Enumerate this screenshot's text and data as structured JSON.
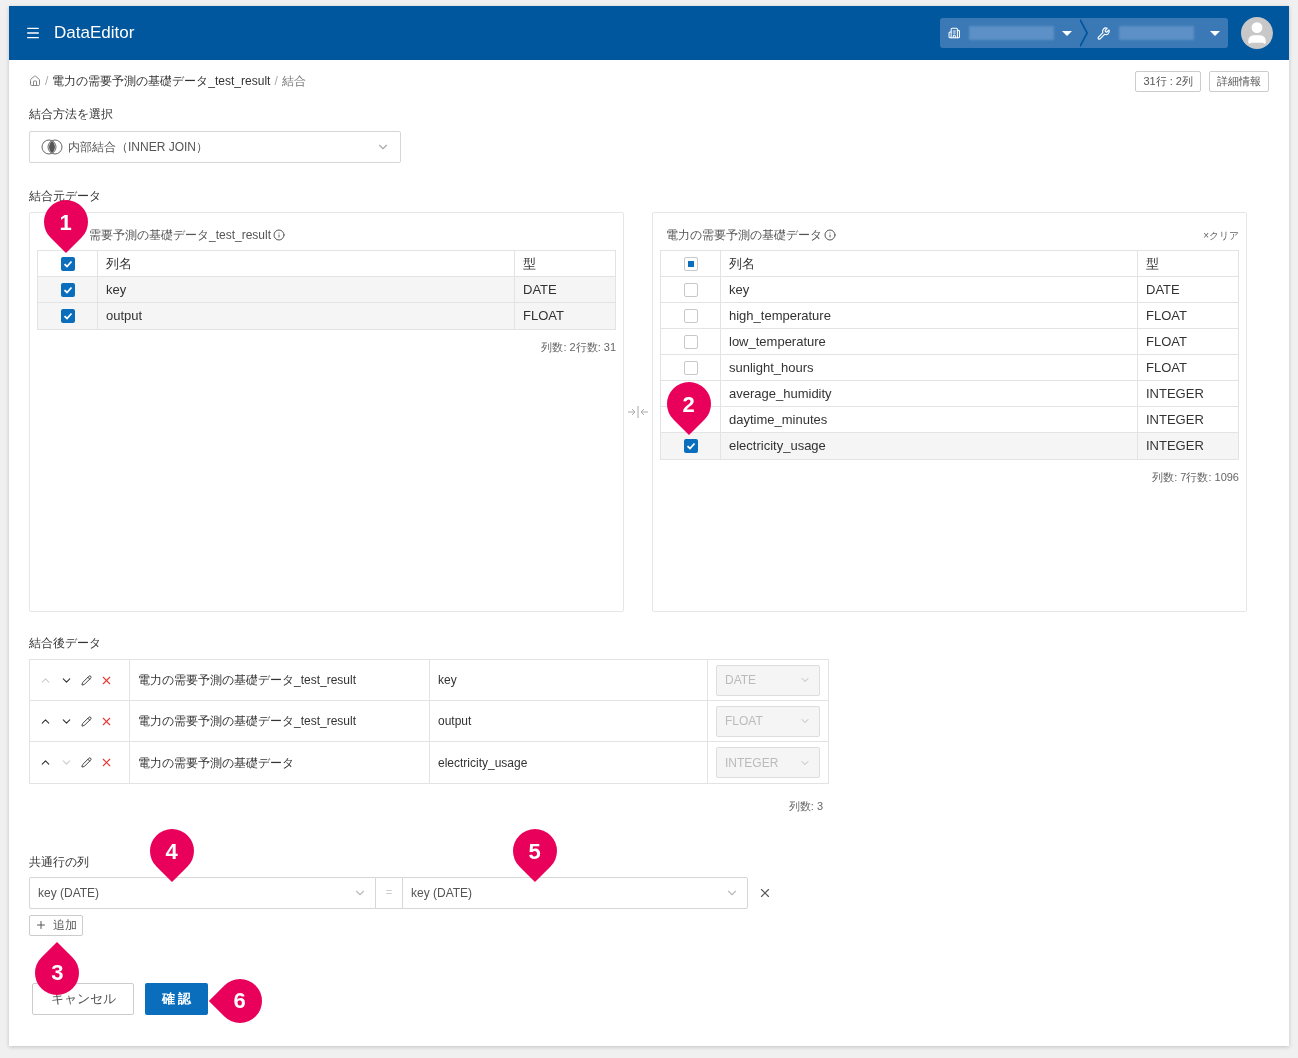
{
  "header": {
    "app_title": "DataEditor"
  },
  "breadcrumb": {
    "items": [
      {
        "kind": "separator",
        "text": "/"
      },
      {
        "kind": "link",
        "text": "電力の需要予測の基礎データ_test_result"
      },
      {
        "kind": "separator",
        "text": "/"
      },
      {
        "kind": "current",
        "text": "結合"
      }
    ]
  },
  "info_buttons": [
    "31行 : 2列",
    "詳細情報"
  ],
  "join_method": {
    "label": "結合方法を選択",
    "value": "内部結合（INNER JOIN）"
  },
  "source_section": {
    "label": "結合元データ"
  },
  "left_table": {
    "title": "需要予測の基礎データ_test_result",
    "header_checkbox": {
      "kind": "checked"
    },
    "columns": [
      "列名",
      "型"
    ],
    "rows": [
      {
        "name": "key",
        "type": "DATE",
        "checked": true
      },
      {
        "name": "output",
        "type": "FLOAT",
        "checked": true
      }
    ],
    "footer": "列数: 2行数: 31"
  },
  "right_table": {
    "title": "電力の需要予測の基礎データ",
    "clear": "×クリア",
    "header_checkbox": {
      "kind": "indeterminate"
    },
    "columns": [
      "列名",
      "型"
    ],
    "rows": [
      {
        "name": "key",
        "type": "DATE",
        "checked": false
      },
      {
        "name": "high_temperature",
        "type": "FLOAT",
        "checked": false
      },
      {
        "name": "low_temperature",
        "type": "FLOAT",
        "checked": false
      },
      {
        "name": "sunlight_hours",
        "type": "FLOAT",
        "checked": false
      },
      {
        "name": "average_humidity",
        "type": "INTEGER"
      },
      {
        "name": "daytime_minutes",
        "type": "INTEGER"
      },
      {
        "name": "electricity_usage",
        "type": "INTEGER",
        "checked": true
      }
    ],
    "footer": "列数: 7行数: 1096"
  },
  "result": {
    "label": "結合後データ",
    "rows": [
      {
        "source": "電力の需要予測の基礎データ_test_result",
        "name": "key",
        "type": "DATE",
        "up_disabled": true,
        "down_disabled": false
      },
      {
        "source": "電力の需要予測の基礎データ_test_result",
        "name": "output",
        "type": "FLOAT",
        "up_disabled": false,
        "down_disabled": false
      },
      {
        "source": "電力の需要予測の基礎データ",
        "name": "electricity_usage",
        "type": "INTEGER",
        "up_disabled": false,
        "down_disabled": true
      }
    ],
    "footer": "列数: 3"
  },
  "common_columns": {
    "label": "共通行の列",
    "pairs": [
      {
        "left": "key (DATE)",
        "equals": "=",
        "right": "key (DATE)"
      }
    ],
    "add_button": "追加"
  },
  "buttons": {
    "cancel": "キャンセル",
    "confirm": "確 認"
  },
  "callouts": [
    {
      "label": "1",
      "kind": "down"
    },
    {
      "label": "2",
      "kind": "down"
    },
    {
      "label": "3",
      "kind": "up"
    },
    {
      "label": "4",
      "kind": "down"
    },
    {
      "label": "5",
      "kind": "down"
    },
    {
      "label": "6",
      "kind": "left"
    }
  ]
}
